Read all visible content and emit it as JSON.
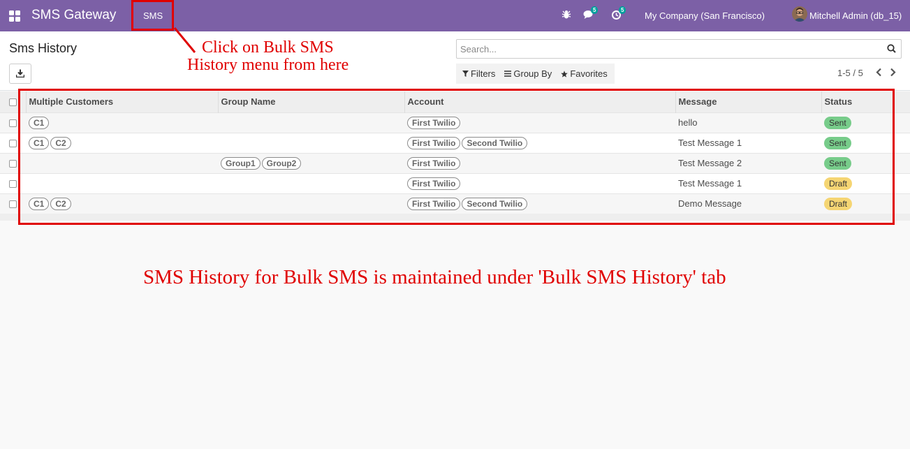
{
  "navbar": {
    "app_title": "SMS Gateway",
    "menu_sms": "SMS",
    "messages_badge": "5",
    "activities_badge": "5",
    "company": "My Company (San Francisco)",
    "user": "Mitchell Admin (db_15)"
  },
  "control_panel": {
    "title": "Sms History",
    "search_placeholder": "Search...",
    "filters_label": "Filters",
    "group_by_label": "Group By",
    "favorites_label": "Favorites",
    "pager": "1-5 / 5"
  },
  "table": {
    "columns": [
      "Multiple Customers",
      "Group Name",
      "Account",
      "Message",
      "Status"
    ],
    "rows": [
      {
        "customers": [
          "C1"
        ],
        "groups": [],
        "accounts": [
          "First Twilio"
        ],
        "message": "hello",
        "status": "Sent"
      },
      {
        "customers": [
          "C1",
          "C2"
        ],
        "groups": [],
        "accounts": [
          "First Twilio",
          "Second Twilio"
        ],
        "message": "Test Message 1",
        "status": "Sent"
      },
      {
        "customers": [],
        "groups": [
          "Group1",
          "Group2"
        ],
        "accounts": [
          "First Twilio"
        ],
        "message": "Test Message 2",
        "status": "Sent"
      },
      {
        "customers": [],
        "groups": [],
        "accounts": [
          "First Twilio"
        ],
        "message": "Test Message 1",
        "status": "Draft"
      },
      {
        "customers": [
          "C1",
          "C2"
        ],
        "groups": [],
        "accounts": [
          "First Twilio",
          "Second Twilio"
        ],
        "message": "Demo Message",
        "status": "Draft"
      }
    ]
  },
  "annotations": {
    "menu_note_line1": "Click on Bulk SMS",
    "menu_note_line2": "History menu from here",
    "history_note": "SMS History for Bulk SMS is maintained under 'Bulk SMS History' tab"
  },
  "colors": {
    "navbar": "#7c60a6",
    "annotation_red": "#e00000",
    "sent_badge": "#77cc8a",
    "draft_badge": "#f5d573",
    "counter_badge": "#00a09d"
  },
  "icons": {
    "apps": "apps-grid-icon",
    "debug": "bug-icon",
    "messages": "chat-icon",
    "activities": "clock-icon",
    "download": "download-icon",
    "search": "search-icon",
    "filter": "filter-icon",
    "group_by": "list-icon",
    "favorites": "star-icon",
    "prev": "chevron-left-icon",
    "next": "chevron-right-icon"
  }
}
